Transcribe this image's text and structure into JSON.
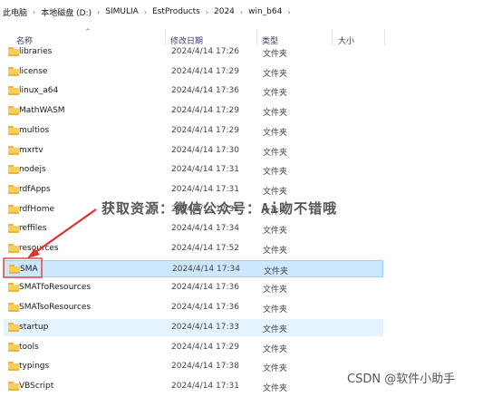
{
  "breadcrumb": [
    "此电脑",
    "本地磁盘 (D:)",
    "SIMULIA",
    "EstProducts",
    "2024",
    "win_b64"
  ],
  "columns": {
    "name": "名称",
    "date": "修改日期",
    "type": "类型",
    "size": "大小"
  },
  "rows": [
    {
      "name": "libraries",
      "date": "2024/4/14 17:26",
      "type": "文件夹"
    },
    {
      "name": "license",
      "date": "2024/4/14 17:29",
      "type": "文件夹"
    },
    {
      "name": "linux_a64",
      "date": "2024/4/14 17:36",
      "type": "文件夹"
    },
    {
      "name": "MathWASM",
      "date": "2024/4/14 17:29",
      "type": "文件夹"
    },
    {
      "name": "multios",
      "date": "2024/4/14 17:29",
      "type": "文件夹"
    },
    {
      "name": "mxrtv",
      "date": "2024/4/14 17:30",
      "type": "文件夹"
    },
    {
      "name": "nodejs",
      "date": "2024/4/14 17:31",
      "type": "文件夹"
    },
    {
      "name": "rdfApps",
      "date": "2024/4/14 17:31",
      "type": "文件夹"
    },
    {
      "name": "rdfHome",
      "date": "2024/4/14 17:31",
      "type": "文件夹"
    },
    {
      "name": "reffiles",
      "date": "2024/4/14 17:34",
      "type": "文件夹"
    },
    {
      "name": "resources",
      "date": "2024/4/14 17:52",
      "type": "文件夹"
    },
    {
      "name": "SMA",
      "date": "2024/4/14 17:34",
      "type": "文件夹"
    },
    {
      "name": "SMATfoResources",
      "date": "2024/4/14 17:36",
      "type": "文件夹"
    },
    {
      "name": "SMATsoResources",
      "date": "2024/4/14 17:36",
      "type": "文件夹"
    },
    {
      "name": "startup",
      "date": "2024/4/14 17:33",
      "type": "文件夹"
    },
    {
      "name": "tools",
      "date": "2024/4/14 17:29",
      "type": "文件夹"
    },
    {
      "name": "typings",
      "date": "2024/4/14 17:38",
      "type": "文件夹"
    },
    {
      "name": "VBScript",
      "date": "2024/4/14 17:31",
      "type": "文件夹"
    }
  ],
  "selected_row": "SMA",
  "hover_row": "startup",
  "overlay": {
    "watermark": "获取资源：微信公众号：Ai吻不错哦",
    "csdn": "CSDN @软件小助手"
  },
  "colors": {
    "selected": "#cce8ff",
    "hover": "#e5f3ff",
    "folder": "#f8cf5a",
    "annotation": "#e03030"
  }
}
